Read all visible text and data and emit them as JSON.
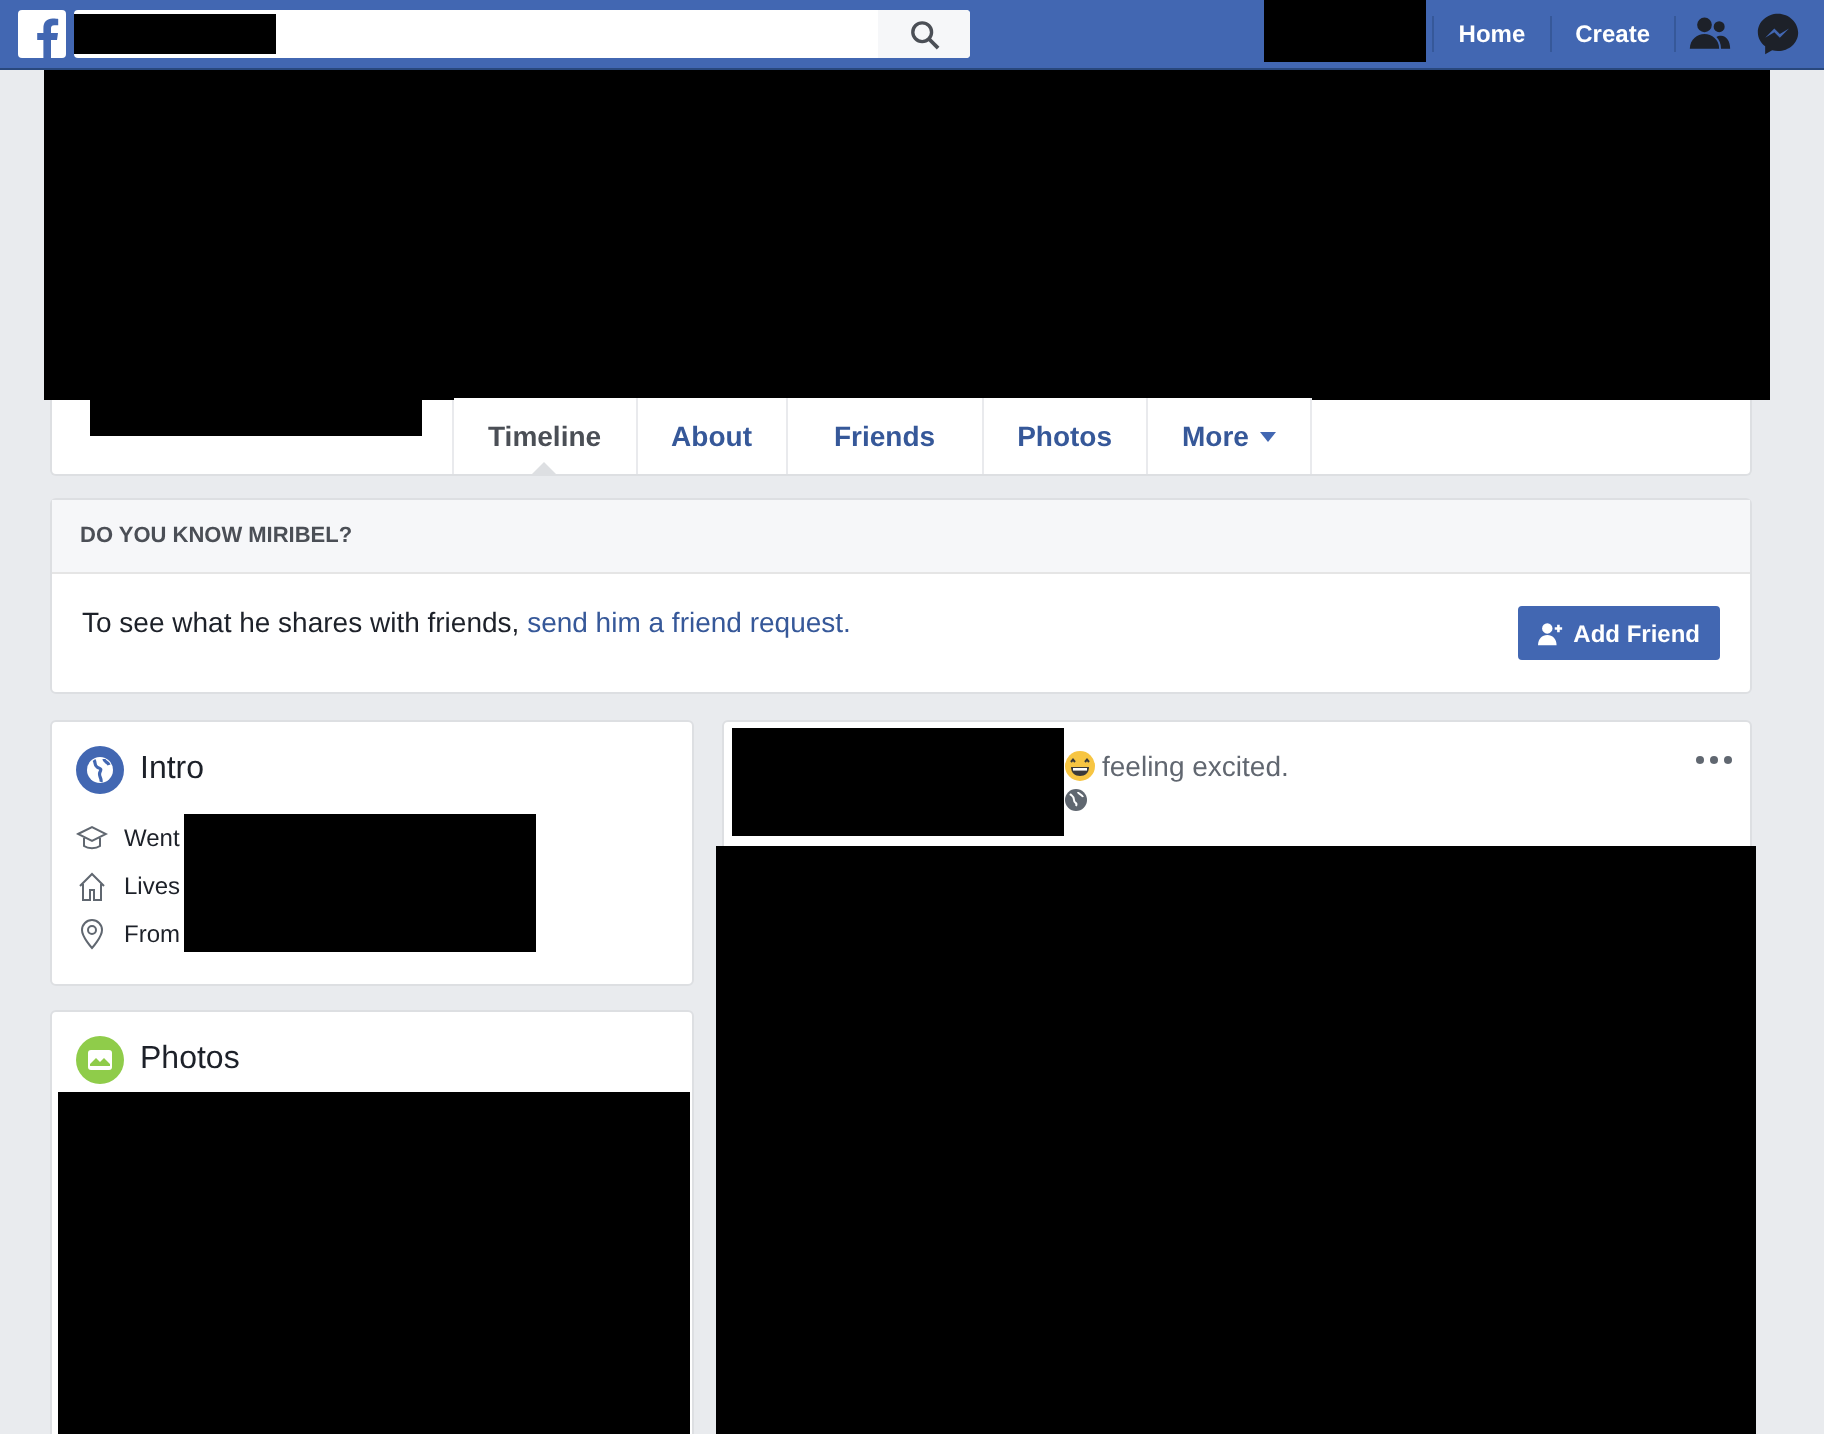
{
  "top_bar": {
    "links": [
      {
        "label": "Home"
      },
      {
        "label": "Create"
      }
    ]
  },
  "profile_tabs": [
    {
      "label": "Timeline",
      "selected": true
    },
    {
      "label": "About",
      "selected": false
    },
    {
      "label": "Friends",
      "selected": false
    },
    {
      "label": "Photos",
      "selected": false
    },
    {
      "label": "More",
      "selected": false,
      "kind": "dropdown"
    }
  ],
  "know_card": {
    "heading": "DO YOU KNOW MIRIBEL?",
    "message": "To see what he shares with friends, ",
    "link": "send him a friend request.",
    "button": "Add Friend"
  },
  "intro": {
    "title": "Intro",
    "items": [
      {
        "kind": "education",
        "label": "Went"
      },
      {
        "kind": "home",
        "label": "Lives"
      },
      {
        "kind": "location",
        "label": "From"
      }
    ]
  },
  "photos": {
    "title": "Photos"
  },
  "post": {
    "feeling": "feeling excited."
  }
}
